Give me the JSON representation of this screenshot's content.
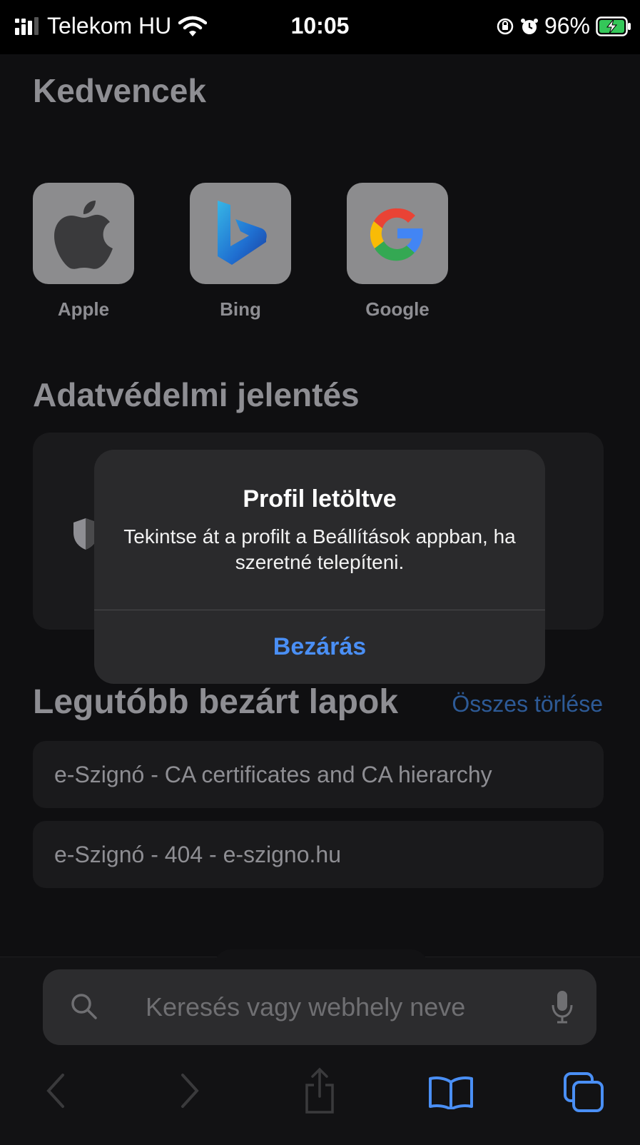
{
  "status": {
    "carrier": "Telekom HU",
    "time": "10:05",
    "battery": "96%"
  },
  "favorites": {
    "title": "Kedvencek",
    "items": [
      {
        "label": "Apple",
        "icon": "apple-logo"
      },
      {
        "label": "Bing",
        "icon": "bing-logo"
      },
      {
        "label": "Google",
        "icon": "google-logo"
      }
    ]
  },
  "privacy": {
    "title": "Adatvédelmi jelentés"
  },
  "recent": {
    "title": "Legutóbb bezárt lapok",
    "clear_all": "Összes törlése",
    "items": [
      "e-Szignó - CA certificates and CA hierarchy",
      "e-Szignó - 404 - e-szigno.hu"
    ]
  },
  "alert": {
    "title": "Profil letöltve",
    "message": "Tekintse át a profilt a Beállítások appban, ha szeretné telepíteni.",
    "button": "Bezárás"
  },
  "search": {
    "placeholder": "Keresés vagy webhely neve"
  },
  "toolbar": {
    "icons": [
      "back-icon",
      "forward-icon",
      "share-icon",
      "bookmarks-icon",
      "tabs-icon"
    ]
  },
  "colors": {
    "accent": "#4a8ff5",
    "background": "#0f0f11",
    "alert_bg": "#2a2a2c"
  }
}
